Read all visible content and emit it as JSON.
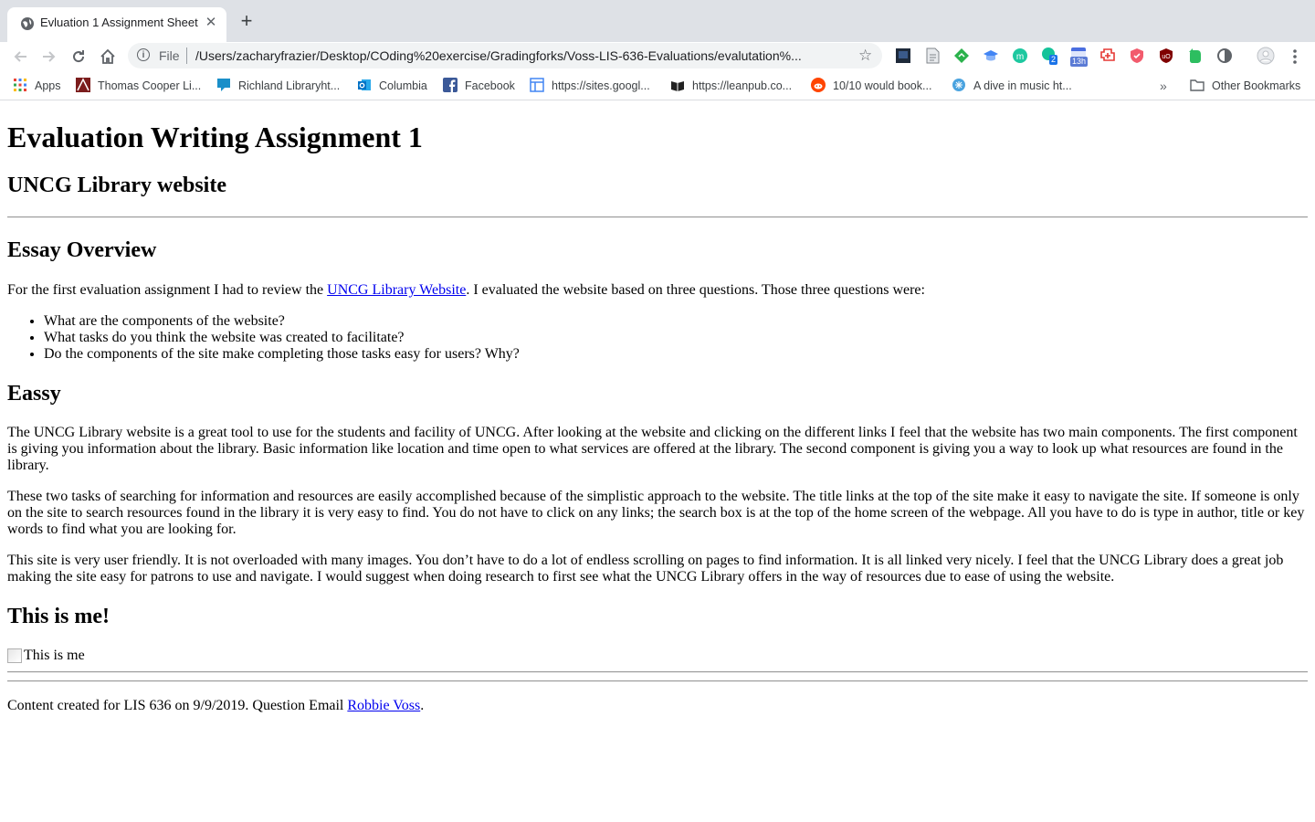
{
  "browser": {
    "tab": {
      "title": "Evluation 1 Assignment Sheet",
      "close": "✕"
    },
    "new_tab": "+",
    "omnibox": {
      "scheme_label": "File",
      "url": "/Users/zacharyfrazier/Desktop/COding%20exercise/Gradingforks/Voss-LIS-636-Evaluations/evalutation%..."
    },
    "extension_labels": {
      "badge_2": "2",
      "badge_13h": "13h"
    },
    "bookmarks": [
      {
        "label": "Apps",
        "icon": "apps-grid-icon"
      },
      {
        "label": "Thomas Cooper Li...",
        "icon": "library-icon"
      },
      {
        "label": "Richland Libraryht...",
        "icon": "library-icon"
      },
      {
        "label": "Columbia",
        "icon": "outlook-icon"
      },
      {
        "label": "Facebook",
        "icon": "facebook-icon"
      },
      {
        "label": "https://sites.googl...",
        "icon": "google-sites-icon"
      },
      {
        "label": "https://leanpub.co...",
        "icon": "leanpub-icon"
      },
      {
        "label": "10/10 would book...",
        "icon": "reddit-icon"
      },
      {
        "label": "A dive in music ht...",
        "icon": "music-icon"
      }
    ],
    "bookmarks_overflow": "»",
    "other_bookmarks": "Other Bookmarks"
  },
  "page": {
    "title": "Evaluation Writing Assignment 1",
    "subtitle": "UNCG Library website",
    "overview_heading": "Essay Overview",
    "overview_intro_before": "For the first evaluation assignment I had to review the ",
    "overview_link": "UNCG Library Website",
    "overview_intro_after": ". I evaluated the website based on three questions. Those three questions were:",
    "questions": [
      "What are the components of the website?",
      "What tasks do you think the website was created to facilitate?",
      "Do the components of the site make completing those tasks easy for users? Why?"
    ],
    "essay_heading": "Eassy",
    "essay_paragraphs": [
      "The UNCG Library website is a great tool to use for the students and facility of UNCG. After looking at the website and clicking on the different links I feel that the website has two main components. The first component is giving you information about the library. Basic information like location and time open to what services are offered at the library. The second component is giving you a way to look up what resources are found in the library.",
      "These two tasks of searching for information and resources are easily accomplished because of the simplistic approach to the website. The title links at the top of the site make it easy to navigate the site. If someone is only on the site to search resources found in the library it is very easy to find. You do not have to click on any links; the search box is at the top of the home screen of the webpage. All you have to do is type in author, title or key words to find what you are looking for.",
      "This site is very user friendly. It is not overloaded with many images. You don’t have to do a lot of endless scrolling on pages to find information. It is all linked very nicely. I feel that the UNCG Library does a great job making the site easy for patrons to use and navigate. I would suggest when doing research to first see what the UNCG Library offers in the way of resources due to ease of using the website."
    ],
    "me_heading": "This is me!",
    "me_image_alt": "This is me",
    "footer_before": "Content created for LIS 636 on 9/9/2019. Question Email ",
    "footer_link": "Robbie Voss",
    "footer_after": "."
  }
}
